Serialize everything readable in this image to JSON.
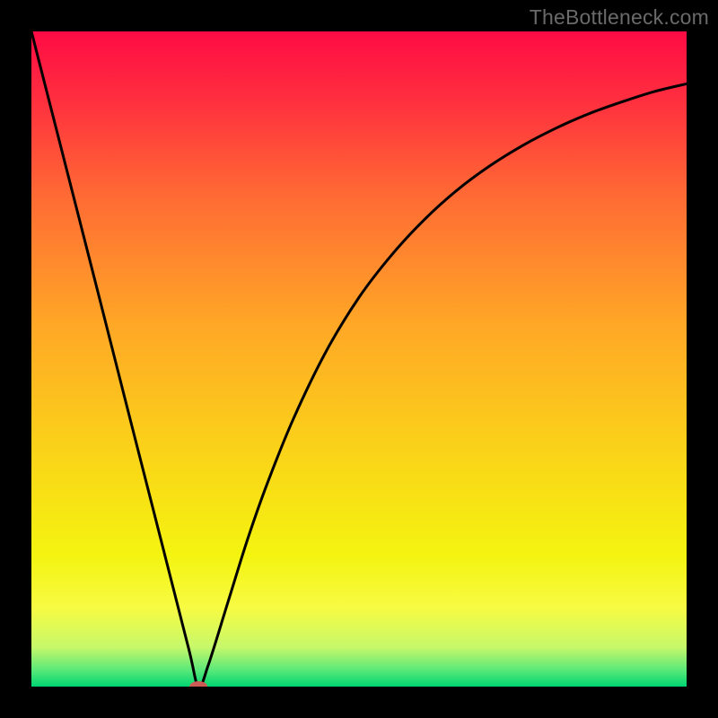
{
  "watermark": "TheBottleneck.com",
  "chart_data": {
    "type": "line",
    "title": "",
    "xlabel": "",
    "ylabel": "",
    "xlim": [
      0,
      100
    ],
    "ylim": [
      0,
      100
    ],
    "grid": false,
    "legend": false,
    "background": {
      "type": "vertical-gradient",
      "stops": [
        {
          "pos": 0.0,
          "color": "#ff0b44"
        },
        {
          "pos": 0.1,
          "color": "#ff2d3f"
        },
        {
          "pos": 0.25,
          "color": "#ff6a34"
        },
        {
          "pos": 0.45,
          "color": "#ffa826"
        },
        {
          "pos": 0.65,
          "color": "#fad518"
        },
        {
          "pos": 0.8,
          "color": "#f4f410"
        },
        {
          "pos": 0.88,
          "color": "#f7fb43"
        },
        {
          "pos": 0.94,
          "color": "#c6f86a"
        },
        {
          "pos": 0.975,
          "color": "#59e879"
        },
        {
          "pos": 1.0,
          "color": "#00d672"
        }
      ]
    },
    "series": [
      {
        "name": "bottleneck-curve",
        "stroke": "#000000",
        "stroke_width": 3,
        "x": [
          0,
          5,
          10,
          15,
          20,
          24,
          25.5,
          27,
          30,
          33,
          36,
          40,
          45,
          50,
          55,
          60,
          65,
          70,
          75,
          80,
          85,
          90,
          95,
          100
        ],
        "y": [
          100,
          80.4,
          60.8,
          41.1,
          21.5,
          5.8,
          0,
          3.3,
          12.9,
          22.5,
          31.0,
          40.9,
          51.2,
          59.4,
          65.9,
          71.3,
          75.8,
          79.5,
          82.6,
          85.2,
          87.4,
          89.2,
          90.8,
          92.0
        ]
      }
    ],
    "marker": {
      "name": "optimum-marker",
      "x": 25.5,
      "y": 0,
      "color": "#cc5a55",
      "rx": 10,
      "ry": 6
    }
  }
}
